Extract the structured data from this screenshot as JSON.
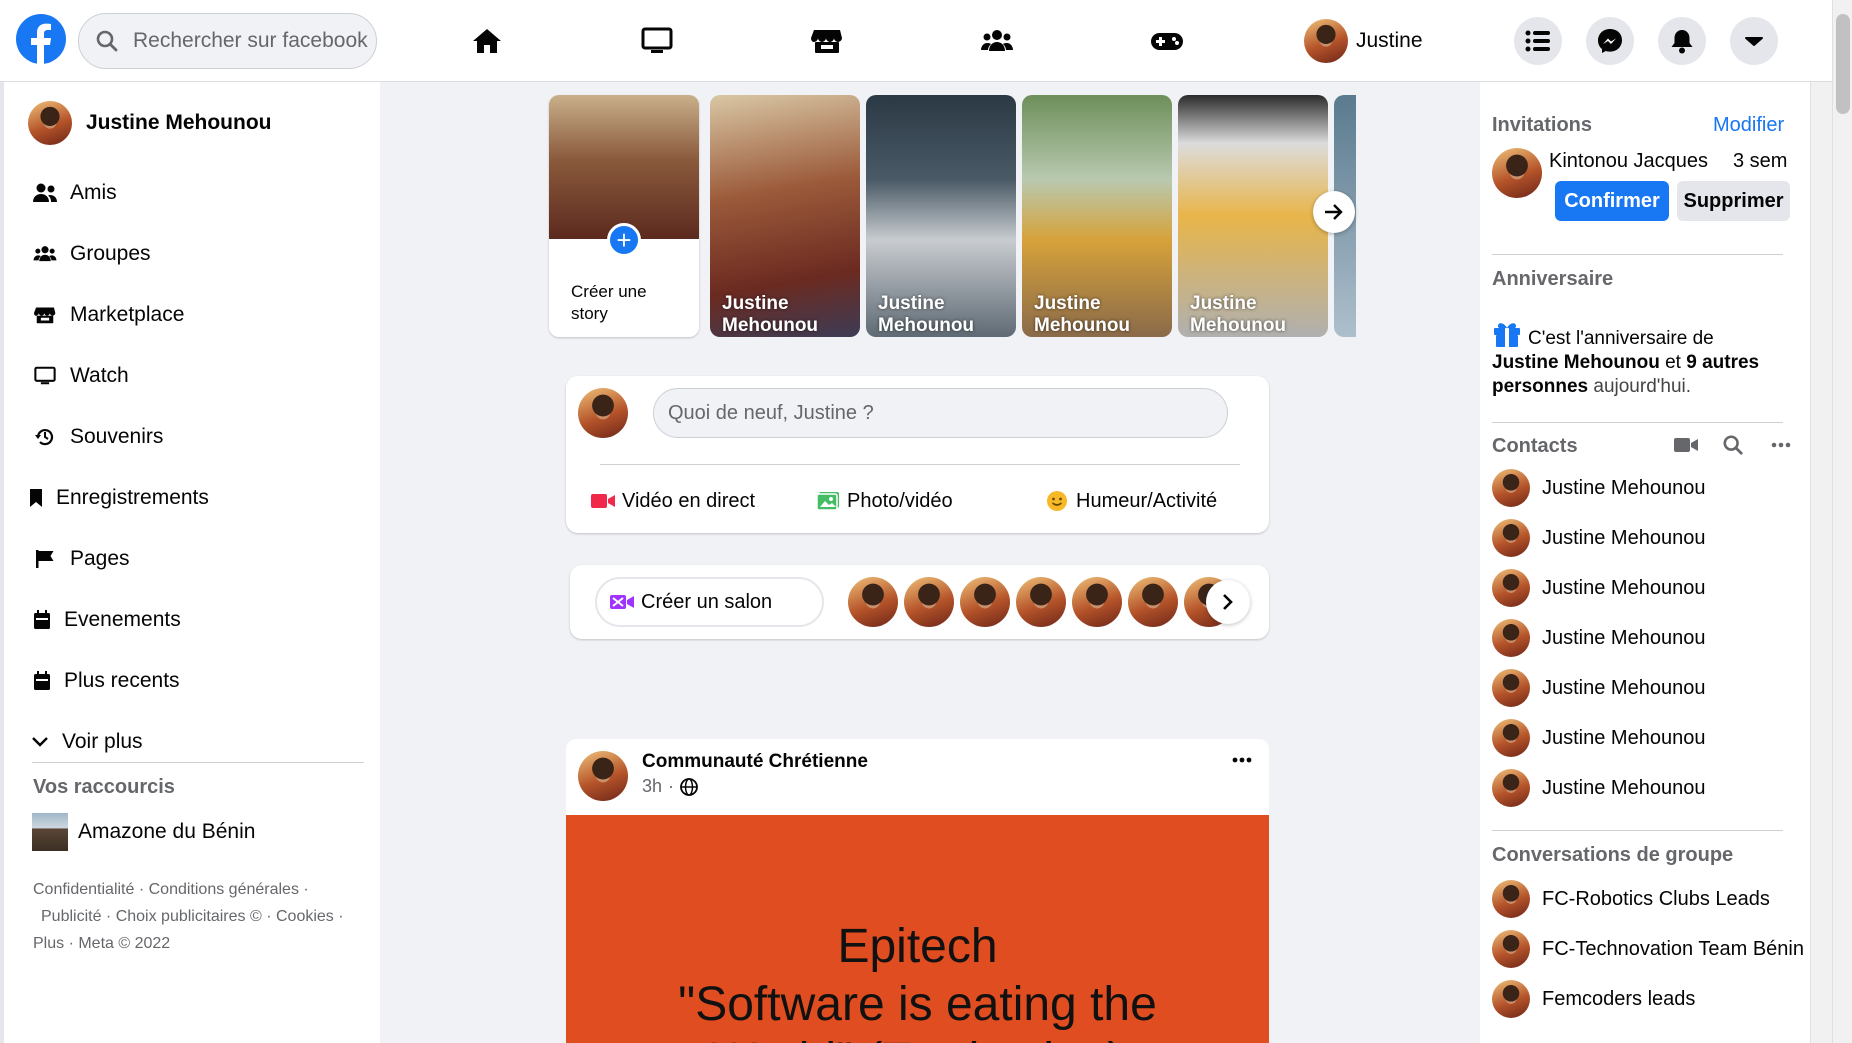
{
  "header": {
    "search_placeholder": "Rechercher sur facebook",
    "profile_name": "Justine",
    "nav_icons": [
      "home-icon",
      "watch-icon",
      "marketplace-icon",
      "groups-icon",
      "gaming-icon"
    ],
    "brand_color": "#1877f2"
  },
  "left_sidebar": {
    "user_name": "Justine Mehounou",
    "items": [
      {
        "label": "Amis",
        "icon": "friends-icon"
      },
      {
        "label": "Groupes",
        "icon": "groups-icon"
      },
      {
        "label": "Marketplace",
        "icon": "marketplace-icon"
      },
      {
        "label": "Watch",
        "icon": "watch-icon"
      },
      {
        "label": "Souvenirs",
        "icon": "memories-icon"
      },
      {
        "label": "Enregistrements",
        "icon": "bookmark-icon"
      },
      {
        "label": "Pages",
        "icon": "flag-icon"
      },
      {
        "label": "Evenements",
        "icon": "calendar-icon"
      },
      {
        "label": "Plus recents",
        "icon": "calendar-icon"
      },
      {
        "label": "Voir plus",
        "icon": "chevron-down-icon"
      }
    ],
    "shortcuts_title": "Vos raccourcis",
    "shortcut": "Amazone du Bénin",
    "footer": {
      "line1": "Confidentialité · Conditions générales · ",
      "line2": "Publicité · Choix publicitaires © · Cookies · ",
      "line3": "Plus · Meta © 2022"
    }
  },
  "stories": {
    "create_label": "Créer une story",
    "items": [
      {
        "name": "Justine Mehounou"
      },
      {
        "name": "Justine Mehounou"
      },
      {
        "name": "Justine Mehounou"
      },
      {
        "name": "Justine Mehounou"
      }
    ]
  },
  "composer": {
    "placeholder": "Quoi de neuf, Justine ?",
    "actions": [
      "Vidéo en direct",
      "Photo/vidéo",
      "Humeur/Activité"
    ]
  },
  "rooms": {
    "create_label": "Créer un salon"
  },
  "post": {
    "author": "Communauté Chrétienne",
    "time": "3h",
    "banner_line1": "Epitech",
    "banner_line2": "\"Software is eating the",
    "banner_line3": "World\" (Traduction)"
  },
  "right_sidebar": {
    "invitations_title": "Invitations",
    "edit_link": "Modifier",
    "invite_name": "Kintonou Jacques",
    "invite_time": "3 sem",
    "confirm_label": "Confirmer",
    "delete_label": "Supprimer",
    "birthday_title": "Anniversaire",
    "birthday_text_1": "C'est l'anniversaire de",
    "birthday_name": "Justine Mehounou",
    "birthday_text_2": " et ",
    "birthday_count": "9 autres personnes",
    "birthday_text_3": " aujourd'hui.",
    "contacts_title": "Contacts",
    "contacts": [
      "Justine Mehounou",
      "Justine Mehounou",
      "Justine Mehounou",
      "Justine Mehounou",
      "Justine Mehounou",
      "Justine Mehounou",
      "Justine Mehounou"
    ],
    "groups_title": "Conversations de groupe",
    "groups": [
      "FC-Robotics Clubs Leads",
      "FC-Technovation Team Bénin",
      "Femcoders leads"
    ]
  }
}
